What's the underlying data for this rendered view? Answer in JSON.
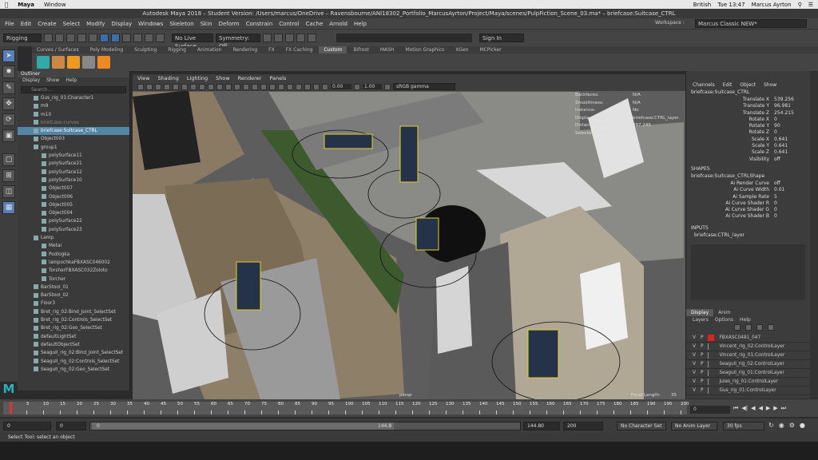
{
  "mac": {
    "app": "Maya",
    "menu_window": "Window",
    "lang": "British",
    "time": "Tue 13:47",
    "user": "Marcus Ayrton"
  },
  "title": "Autodesk Maya 2018 – Student Version: /Users/marcus/OneDrive – Ravensbourne/ANI18302_Portfolio_MarcusAyrton/Project/Maya/scenes/PulpFiction_Scene_03.ma*  –  briefcase:Suitcase_CTRL",
  "menu": [
    "File",
    "Edit",
    "Create",
    "Select",
    "Modify",
    "Display",
    "Windows",
    "Skeleton",
    "Skin",
    "Deform",
    "Constrain",
    "Control",
    "Cache",
    "Arnold",
    "Help"
  ],
  "workspace_label": "Workspace :",
  "workspace_value": "Marcus Classic NEW*",
  "status": {
    "menuset": "Rigging",
    "live": "No Live Surface",
    "symmetry": "Symmetry: Off",
    "signin": "Sign In"
  },
  "shelf_tabs": [
    "Curves / Surfaces",
    "Poly Modeling",
    "Sculpting",
    "Rigging",
    "Animation",
    "Rendering",
    "FX",
    "FX Caching",
    "Custom",
    "Bifrost",
    "MASH",
    "Motion Graphics",
    "XGen",
    "MCPicker"
  ],
  "shelf_active": "Custom",
  "outliner": {
    "title": "Outliner",
    "menu": [
      "Display",
      "Show",
      "Help"
    ],
    "search": "Search...",
    "items": [
      {
        "label": "Gus_rig_01:Character1",
        "ind": false,
        "sel": false,
        "dim": false
      },
      {
        "label": "m9",
        "ind": false,
        "sel": false,
        "dim": false
      },
      {
        "label": "m10",
        "ind": false,
        "sel": false,
        "dim": false
      },
      {
        "label": "briefcase:curves",
        "ind": false,
        "sel": false,
        "dim": true
      },
      {
        "label": "briefcase:Suitcase_CTRL",
        "ind": false,
        "sel": true,
        "dim": false
      },
      {
        "label": "Object003",
        "ind": false,
        "sel": false,
        "dim": false
      },
      {
        "label": "group1",
        "ind": false,
        "sel": false,
        "dim": false
      },
      {
        "label": "polySurface11",
        "ind": true,
        "sel": false,
        "dim": false
      },
      {
        "label": "polySurface21",
        "ind": true,
        "sel": false,
        "dim": false
      },
      {
        "label": "polySurface12",
        "ind": true,
        "sel": false,
        "dim": false
      },
      {
        "label": "polySurface10",
        "ind": true,
        "sel": false,
        "dim": false
      },
      {
        "label": "Object007",
        "ind": true,
        "sel": false,
        "dim": false
      },
      {
        "label": "Object006",
        "ind": true,
        "sel": false,
        "dim": false
      },
      {
        "label": "Object005",
        "ind": true,
        "sel": false,
        "dim": false
      },
      {
        "label": "Object004",
        "ind": true,
        "sel": false,
        "dim": false
      },
      {
        "label": "polySurface22",
        "ind": true,
        "sel": false,
        "dim": false
      },
      {
        "label": "polySurface23",
        "ind": true,
        "sel": false,
        "dim": false
      },
      {
        "label": "Lamp",
        "ind": false,
        "sel": false,
        "dim": false
      },
      {
        "label": "Metal",
        "ind": true,
        "sel": false,
        "dim": false
      },
      {
        "label": "Podlogka",
        "ind": true,
        "sel": false,
        "dim": false
      },
      {
        "label": "lampochkaFBXASC046002",
        "ind": true,
        "sel": false,
        "dim": false
      },
      {
        "label": "TorsherFBXASC032Zoloto",
        "ind": true,
        "sel": false,
        "dim": false
      },
      {
        "label": "Torcher",
        "ind": true,
        "sel": false,
        "dim": false
      },
      {
        "label": "BarStool_01",
        "ind": false,
        "sel": false,
        "dim": false
      },
      {
        "label": "BarStool_02",
        "ind": false,
        "sel": false,
        "dim": false
      },
      {
        "label": "Floor3",
        "ind": false,
        "sel": false,
        "dim": false
      },
      {
        "label": "Bret_rig_02:Bind_Joint_SelectSet",
        "ind": false,
        "sel": false,
        "dim": false
      },
      {
        "label": "Bret_rig_02:Controls_SelectSet",
        "ind": false,
        "sel": false,
        "dim": false
      },
      {
        "label": "Bret_rig_02:Geo_SelectSet",
        "ind": false,
        "sel": false,
        "dim": false
      },
      {
        "label": "defaultLightSet",
        "ind": false,
        "sel": false,
        "dim": false
      },
      {
        "label": "defaultObjectSet",
        "ind": false,
        "sel": false,
        "dim": false
      },
      {
        "label": "Seagull_rig_02:Bind_Joint_SelectSet",
        "ind": false,
        "sel": false,
        "dim": false
      },
      {
        "label": "Seagull_rig_02:Controls_SelectSet",
        "ind": false,
        "sel": false,
        "dim": false
      },
      {
        "label": "Seagull_rig_02:Geo_SelectSet",
        "ind": false,
        "sel": false,
        "dim": false
      }
    ]
  },
  "viewport": {
    "menu": [
      "View",
      "Shading",
      "Lighting",
      "Show",
      "Renderer",
      "Panels"
    ],
    "near": "0.00",
    "far": "1.00",
    "colorspace": "sRGB gamma",
    "hud": [
      [
        "Backfaces:",
        "N/A"
      ],
      [
        "Smoothness:",
        "N/A"
      ],
      [
        "Instance:",
        "No"
      ],
      [
        "Display Layer:",
        "briefcase:CTRL_layer"
      ],
      [
        "Distance From Camera:",
        "897.249"
      ],
      [
        "Selected Objects:",
        "1"
      ]
    ],
    "camera": "persp",
    "focal_label": "Focal Length:",
    "focal_value": "35"
  },
  "channelbox": {
    "menu": [
      "Channels",
      "Edit",
      "Object",
      "Show"
    ],
    "object": "briefcase:Suitcase_CTRL",
    "attrs": [
      [
        "Translate X",
        "539.256"
      ],
      [
        "Translate Y",
        "96.981"
      ],
      [
        "Translate Z",
        "254.215"
      ],
      [
        "Rotate X",
        "0"
      ],
      [
        "Rotate Y",
        "90"
      ],
      [
        "Rotate Z",
        "0"
      ],
      [
        "Scale X",
        "0.641"
      ],
      [
        "Scale Y",
        "0.641"
      ],
      [
        "Scale Z",
        "0.641"
      ],
      [
        "Visibility",
        "off"
      ]
    ],
    "shapes_label": "SHAPES",
    "shape_name": "briefcase:Suitcase_CTRLShape",
    "shape_attrs": [
      [
        "Ai Render Curve",
        "off"
      ],
      [
        "Ai Curve Width",
        "0.01"
      ],
      [
        "Ai Sample Rate",
        "5"
      ],
      [
        "Ai Curve Shader R",
        "0"
      ],
      [
        "Ai Curve Shader G",
        "0"
      ],
      [
        "Ai Curve Shader B",
        "0"
      ]
    ],
    "inputs_label": "INPUTS",
    "input_name": "briefcase:CTRL_layer"
  },
  "layers": {
    "tabs": [
      "Display",
      "Anim"
    ],
    "menu": [
      "Layers",
      "Options",
      "Help"
    ],
    "rows": [
      [
        "V",
        "P",
        "FBXASC0481_047"
      ],
      [
        "V",
        "P",
        "Vincent_rig_02:ControlLayer"
      ],
      [
        "V",
        "P",
        "Vincent_rig_01:ControlLayer"
      ],
      [
        "V",
        "P",
        "Seagull_rig_02:ControlLayer"
      ],
      [
        "V",
        "P",
        "Seagull_rig_01:ControlLayer"
      ],
      [
        "V",
        "P",
        "Jules_rig_01:ControlLayer"
      ],
      [
        "V",
        "P",
        "Gus_rig_01:ControlLayer"
      ]
    ]
  },
  "timeline": {
    "ticks": [
      "0",
      "5",
      "10",
      "15",
      "20",
      "25",
      "30",
      "35",
      "40",
      "45",
      "50",
      "55",
      "60",
      "65",
      "70",
      "75",
      "80",
      "85",
      "90",
      "95",
      "100",
      "105",
      "110",
      "115",
      "120",
      "125",
      "130",
      "135",
      "140",
      "145",
      "150",
      "155",
      "160",
      "165",
      "170",
      "175",
      "180",
      "185",
      "190",
      "195",
      "200"
    ],
    "current": "0"
  },
  "range": {
    "start": "0",
    "inner_start": "0",
    "slider_value": "144.8",
    "inner_end": "144.80",
    "end": "200",
    "char_set": "No Character Set",
    "anim_layer": "No Anim Layer",
    "fps": "30 fps"
  },
  "help": "Select Tool: select an object",
  "colors": {
    "accent": "#5285a6",
    "maya": "#2bb0c0"
  }
}
